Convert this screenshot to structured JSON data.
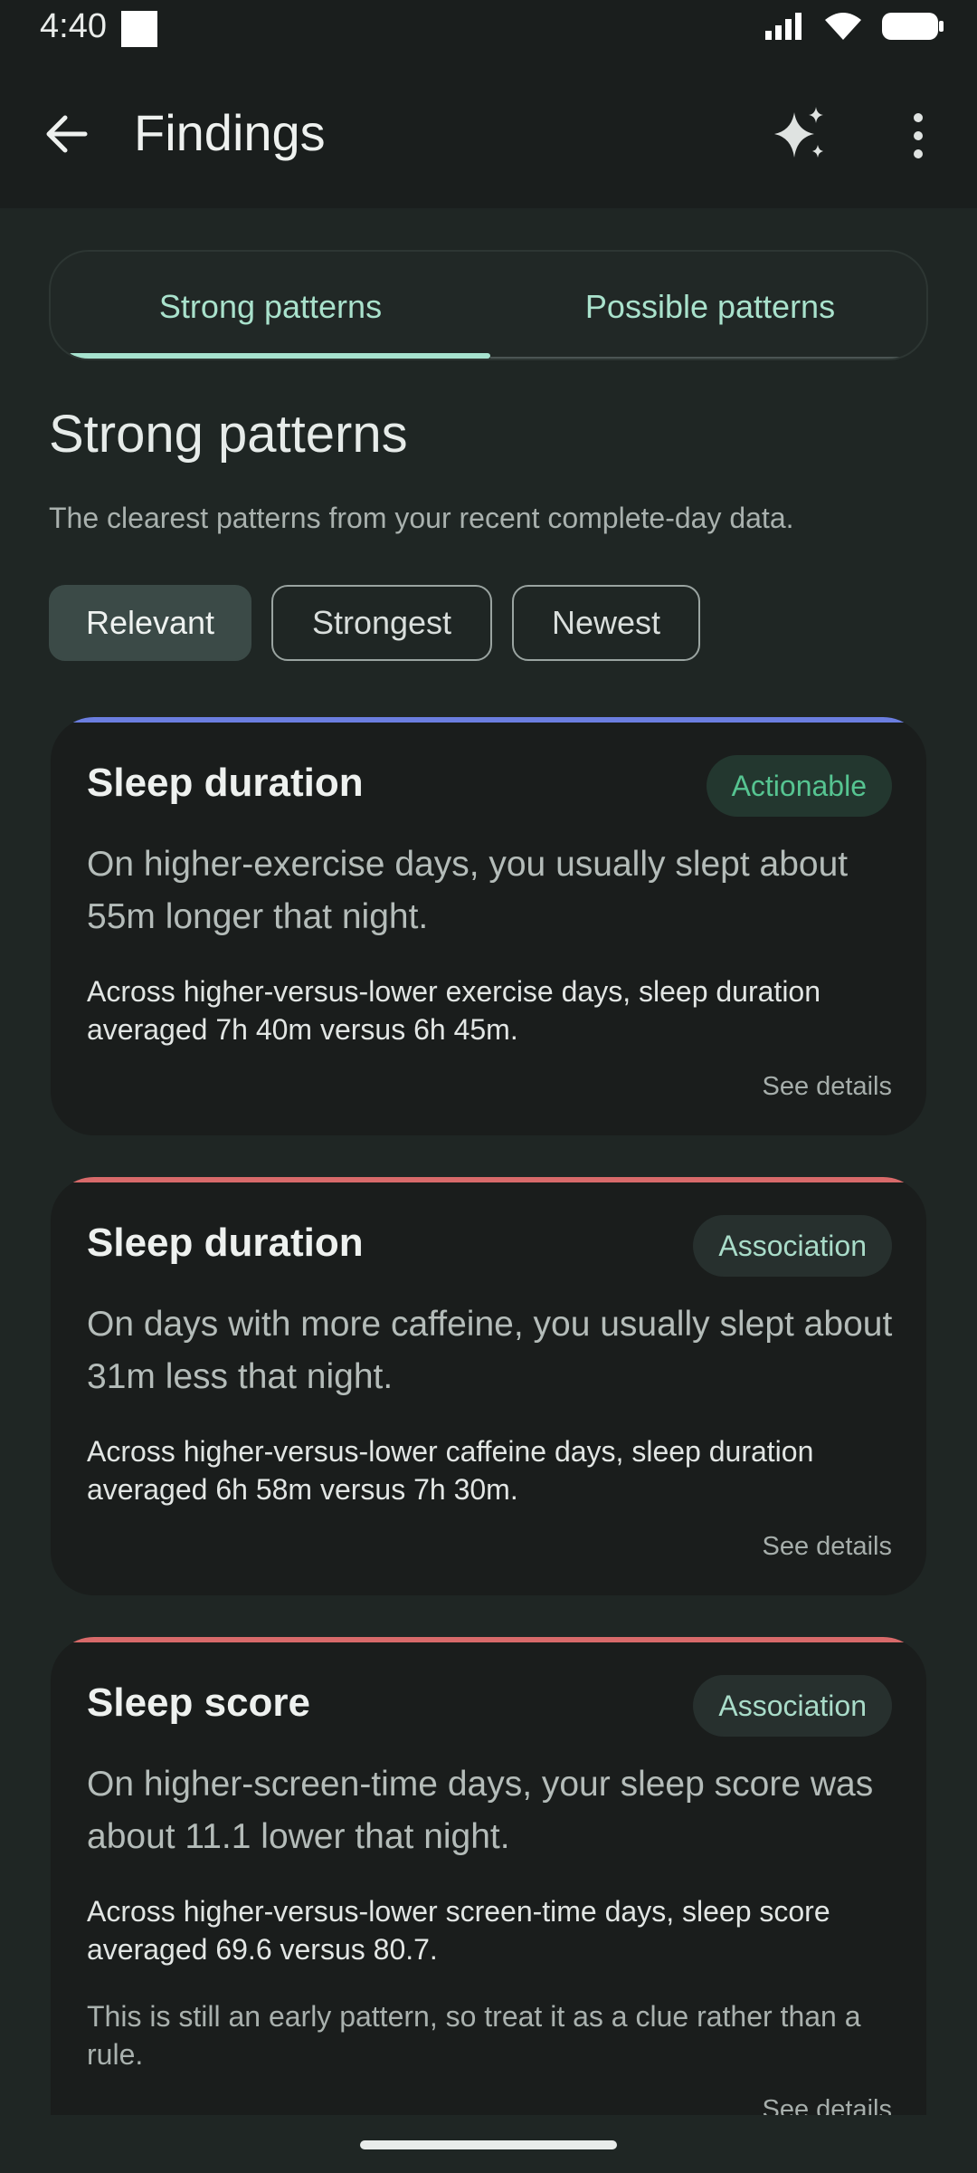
{
  "status": {
    "time": "4:40"
  },
  "appbar": {
    "title": "Findings"
  },
  "tabs": [
    {
      "label": "Strong patterns",
      "selected": true
    },
    {
      "label": "Possible patterns",
      "selected": false
    }
  ],
  "section": {
    "title": "Strong patterns",
    "subtitle": "The clearest patterns from your recent complete-day data."
  },
  "filters": [
    {
      "label": "Relevant",
      "selected": true
    },
    {
      "label": "Strongest",
      "selected": false
    },
    {
      "label": "Newest",
      "selected": false
    }
  ],
  "cards": [
    {
      "title": "Sleep duration",
      "badge": "Actionable",
      "accent_color": "#6b7ee0",
      "main": "On higher-exercise days, you usually slept about 55m longer that night.",
      "detail": "Across higher-versus-lower exercise days, sleep duration averaged 7h 40m versus 6h 45m.",
      "link": "See details"
    },
    {
      "title": "Sleep duration",
      "badge": "Association",
      "accent_color": "#d86a6a",
      "main": "On days with more caffeine, you usually slept about 31m less that night.",
      "detail": "Across higher-versus-lower caffeine days, sleep duration averaged 6h 58m versus 7h 30m.",
      "link": "See details"
    },
    {
      "title": "Sleep score",
      "badge": "Association",
      "accent_color": "#d86a6a",
      "main": "On higher-screen-time days, your sleep score was about 11.1 lower that night.",
      "detail": "Across higher-versus-lower screen-time days, sleep score averaged 69.6 versus 80.7.",
      "note": "This is still an early pattern, so treat it as a clue rather than a rule.",
      "link": "See details"
    }
  ]
}
